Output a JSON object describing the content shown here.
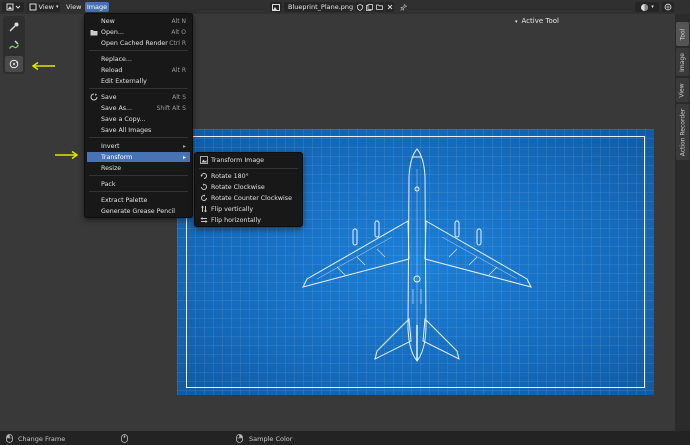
{
  "header": {
    "view_label": "View",
    "view_menu": "View",
    "image_menu": "Image",
    "filename": "Blueprint_Plane.png",
    "panel_title": "Active Tool"
  },
  "image_menu_items": [
    {
      "label": "New",
      "shortcut": "Alt N",
      "icon": "new-icon"
    },
    {
      "label": "Open...",
      "shortcut": "Alt O",
      "icon": "folder-icon"
    },
    {
      "label": "Open Cached Render",
      "shortcut": "Ctrl R"
    },
    {
      "label": "Replace..."
    },
    {
      "label": "Reload",
      "shortcut": "Alt R"
    },
    {
      "label": "Edit Externally"
    },
    {
      "label": "Save",
      "shortcut": "Alt S",
      "icon": "save-icon"
    },
    {
      "label": "Save As...",
      "shortcut": "Shift Alt S"
    },
    {
      "label": "Save a Copy..."
    },
    {
      "label": "Save All Images"
    },
    {
      "label": "Invert",
      "submenu": true
    },
    {
      "label": "Transform",
      "submenu": true
    },
    {
      "label": "Resize"
    },
    {
      "label": "Pack"
    },
    {
      "label": "Extract Palette"
    },
    {
      "label": "Generate Grease Pencil"
    }
  ],
  "transform_submenu": {
    "title": "Transform Image",
    "items": [
      {
        "label": "Rotate 180°"
      },
      {
        "label": "Rotate Clockwise"
      },
      {
        "label": "Rotate Counter Clockwise"
      },
      {
        "label": "Flip vertically"
      },
      {
        "label": "Flip horizontally"
      }
    ]
  },
  "sidebar_tabs": [
    "Tool",
    "Image",
    "View",
    "Action Recorder"
  ],
  "status": {
    "left": "Change Frame",
    "right": "Sample Color"
  },
  "colors": {
    "accent": "#4772b3",
    "blueprint": "#1670c4",
    "annotation_arrow": "#e5e500"
  }
}
